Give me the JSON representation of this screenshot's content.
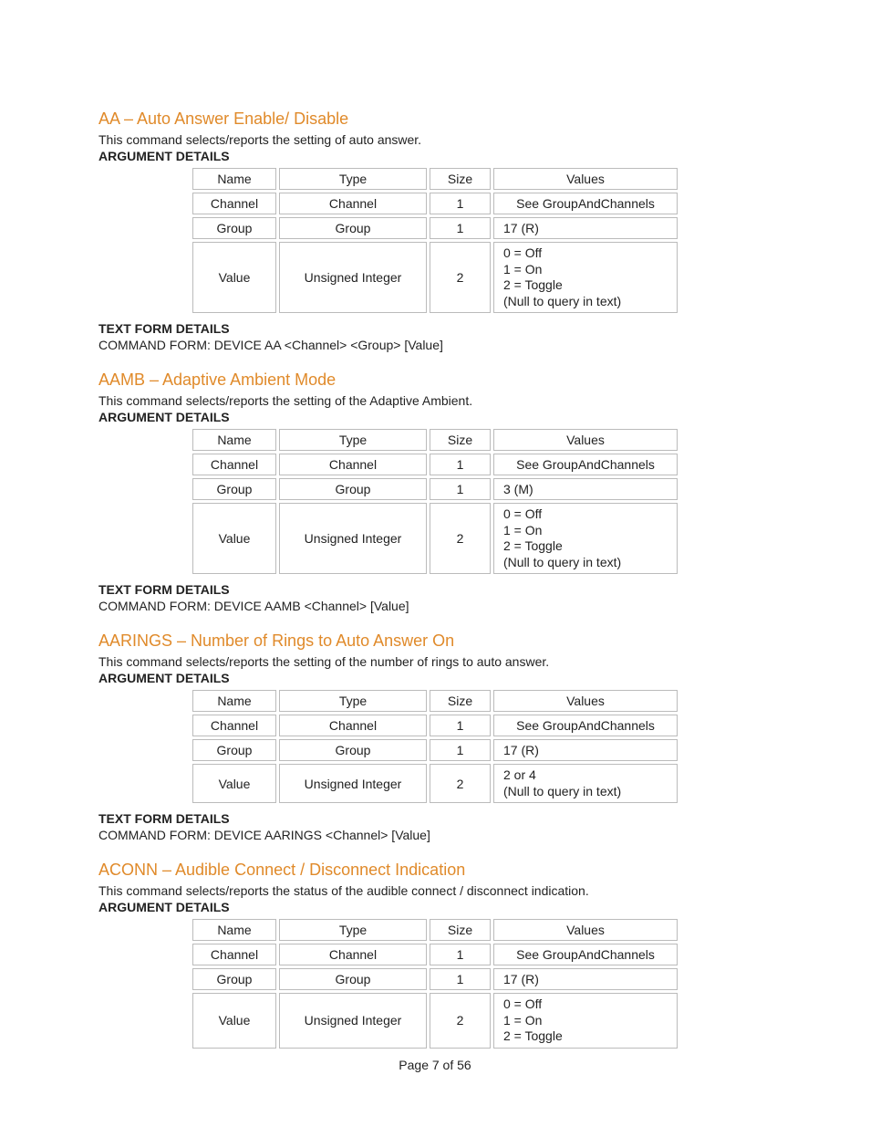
{
  "labels": {
    "argument_details": "ARGUMENT DETAILS",
    "text_form_details": "TEXT FORM DETAILS",
    "command_form_prefix": "COMMAND FORM: ",
    "table_headers": {
      "name": "Name",
      "type": "Type",
      "size": "Size",
      "values": "Values"
    }
  },
  "sections": [
    {
      "title": "AA – Auto Answer Enable/ Disable",
      "description": "This command selects/reports the setting of auto answer.",
      "command_form": "DEVICE AA <Channel> <Group> [Value]",
      "rows": [
        {
          "name": "Channel",
          "type": "Channel",
          "size": "1",
          "values": "See GroupAndChannels",
          "values_align": "c"
        },
        {
          "name": "Group",
          "type": "Group",
          "size": "1",
          "values": "17 (R)",
          "values_align": "l"
        },
        {
          "name": "Value",
          "type": "Unsigned Integer",
          "size": "2",
          "values": "0 = Off\n1 = On\n2 = Toggle\n(Null to query in text)",
          "values_align": "l"
        }
      ]
    },
    {
      "title": "AAMB – Adaptive Ambient Mode",
      "description": "This command selects/reports the setting of the Adaptive Ambient.",
      "command_form": "DEVICE AAMB <Channel> [Value]",
      "rows": [
        {
          "name": "Channel",
          "type": "Channel",
          "size": "1",
          "values": "See GroupAndChannels",
          "values_align": "c"
        },
        {
          "name": "Group",
          "type": "Group",
          "size": "1",
          "values": "3 (M)",
          "values_align": "l"
        },
        {
          "name": "Value",
          "type": "Unsigned Integer",
          "size": "2",
          "values": "0 = Off\n1 = On\n2 = Toggle\n(Null to query in text)",
          "values_align": "l"
        }
      ]
    },
    {
      "title": "AARINGS – Number of Rings to Auto Answer On",
      "description": "This command selects/reports the setting of the number of rings to auto answer.",
      "command_form": "DEVICE AARINGS <Channel> [Value]",
      "rows": [
        {
          "name": "Channel",
          "type": "Channel",
          "size": "1",
          "values": "See GroupAndChannels",
          "values_align": "c"
        },
        {
          "name": "Group",
          "type": "Group",
          "size": "1",
          "values": "17 (R)",
          "values_align": "l"
        },
        {
          "name": "Value",
          "type": "Unsigned Integer",
          "size": "2",
          "values": "2 or 4\n(Null to query in text)",
          "values_align": "l"
        }
      ]
    },
    {
      "title": "ACONN – Audible Connect / Disconnect Indication",
      "description": "This command selects/reports the status of the audible connect / disconnect indication.",
      "command_form": "",
      "rows": [
        {
          "name": "Channel",
          "type": "Channel",
          "size": "1",
          "values": "See GroupAndChannels",
          "values_align": "c"
        },
        {
          "name": "Group",
          "type": "Group",
          "size": "1",
          "values": "17 (R)",
          "values_align": "l"
        },
        {
          "name": "Value",
          "type": "Unsigned Integer",
          "size": "2",
          "values": "0 = Off\n1 = On\n2 = Toggle",
          "values_align": "l"
        }
      ]
    }
  ],
  "footer": {
    "page_current": "7",
    "page_total": "56",
    "text": "Page 7 of 56"
  }
}
